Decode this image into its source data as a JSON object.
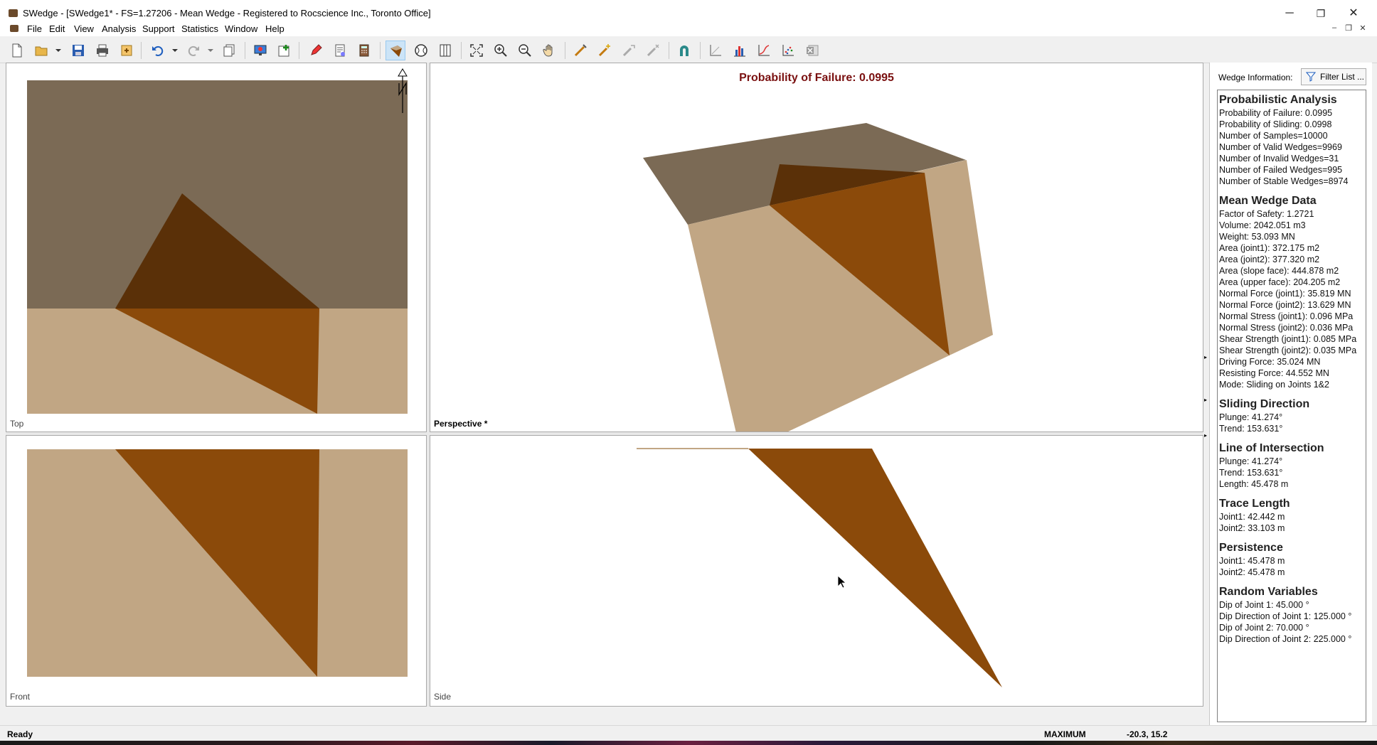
{
  "window": {
    "title": "SWedge - [SWedge1* - FS=1.27206 - Mean Wedge - Registered to Rocscience Inc., Toronto Office]",
    "minimize": "─",
    "restore": "❐",
    "close": "✕"
  },
  "menu": {
    "items": [
      "File",
      "Edit",
      "View",
      "Analysis",
      "Support",
      "Statistics",
      "Window",
      "Help"
    ]
  },
  "colors": {
    "rock_dark": "#7b6a55",
    "rock_light": "#c1a684",
    "wedge_dark": "#5a3008",
    "wedge": "#8b4a0a",
    "title_red": "#7a1010"
  },
  "views": {
    "top_label": "Top",
    "perspective_label": "Perspective *",
    "front_label": "Front",
    "side_label": "Side",
    "perspective_title": "Probability of Failure: 0.0995"
  },
  "side_panel": {
    "header_label": "Wedge Information:",
    "filter_button": "Filter List ...",
    "sections": [
      {
        "title": "Probabilistic Analysis",
        "lines": [
          "Probability of Failure: 0.0995",
          "Probability of Sliding: 0.0998",
          "Number of Samples=10000",
          "Number of Valid Wedges=9969",
          "Number of Invalid Wedges=31",
          "Number of Failed Wedges=995",
          "Number of Stable Wedges=8974"
        ]
      },
      {
        "title": "Mean Wedge Data",
        "lines": [
          "Factor of Safety: 1.2721",
          "Volume: 2042.051 m3",
          "Weight: 53.093 MN",
          "Area (joint1): 372.175 m2",
          "Area (joint2): 377.320 m2",
          "Area (slope face): 444.878 m2",
          "Area (upper face): 204.205 m2",
          "Normal Force (joint1): 35.819 MN",
          "Normal Force (joint2): 13.629 MN",
          "Normal Stress (joint1): 0.096 MPa",
          "Normal Stress (joint2): 0.036 MPa",
          "Shear Strength (joint1): 0.085 MPa",
          "Shear Strength (joint2): 0.035 MPa",
          "Driving Force: 35.024 MN",
          "Resisting Force: 44.552 MN",
          "Mode: Sliding on Joints 1&2"
        ]
      },
      {
        "title": "Sliding Direction",
        "lines": [
          "Plunge: 41.274°",
          "Trend: 153.631°"
        ]
      },
      {
        "title": "Line of Intersection",
        "lines": [
          "Plunge: 41.274°",
          "Trend: 153.631°",
          "Length: 45.478 m"
        ]
      },
      {
        "title": "Trace Length",
        "lines": [
          "Joint1: 42.442 m",
          "Joint2: 33.103 m"
        ]
      },
      {
        "title": "Persistence",
        "lines": [
          "Joint1: 45.478 m",
          "Joint2: 45.478 m"
        ]
      },
      {
        "title": "Random Variables",
        "lines": [
          "Dip of Joint 1: 45.000 °",
          "Dip Direction of Joint 1: 125.000 °",
          "Dip of Joint 2: 70.000 °",
          "Dip Direction of Joint 2: 225.000 °"
        ]
      }
    ]
  },
  "status": {
    "ready": "Ready",
    "mode": "MAXIMUM",
    "coords": "-20.3, 15.2"
  }
}
